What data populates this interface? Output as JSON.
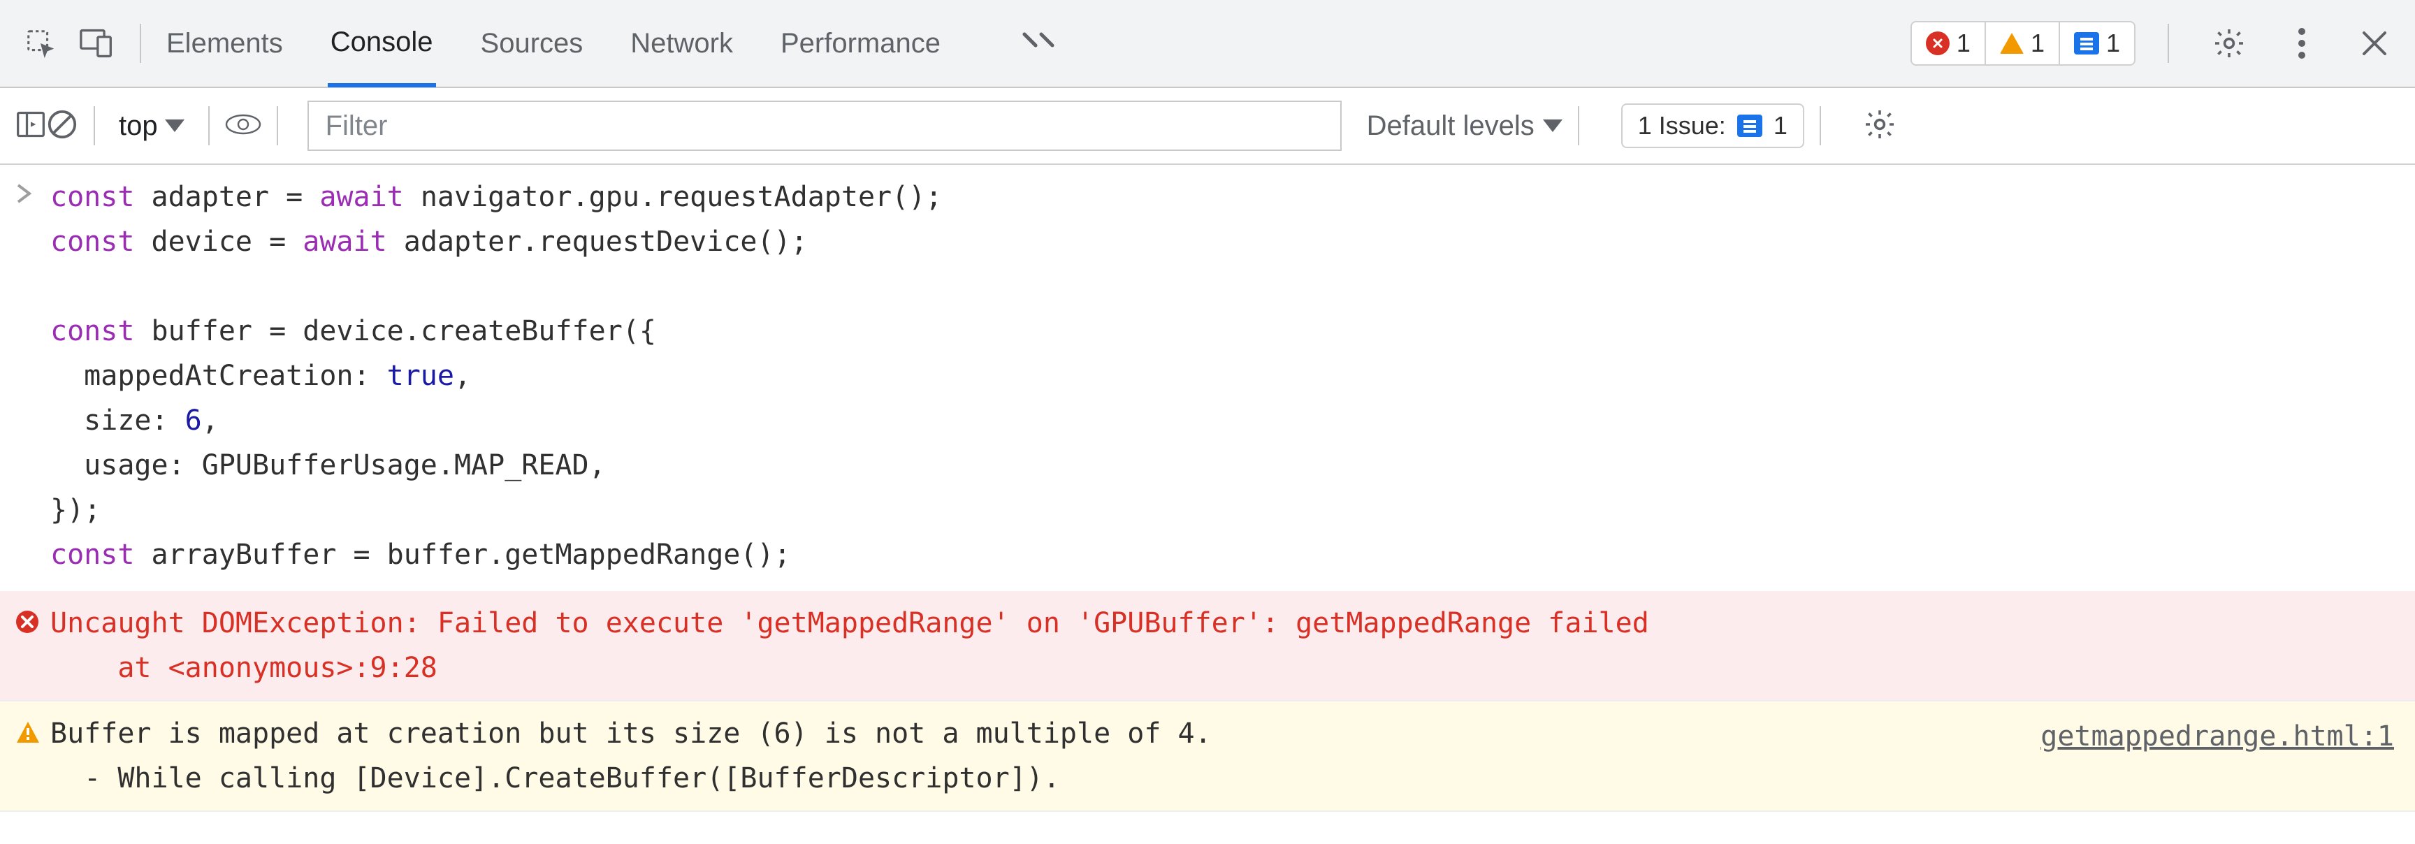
{
  "tabs": {
    "items": [
      "Elements",
      "Console",
      "Sources",
      "Network",
      "Performance"
    ],
    "active_index": 1
  },
  "top_badges": {
    "errors": "1",
    "warnings": "1",
    "info": "1"
  },
  "toolbar": {
    "context": "top",
    "filter_placeholder": "Filter",
    "levels_label": "Default levels",
    "issues_label": "1 Issue:",
    "issues_count": "1"
  },
  "console": {
    "input_code": "const adapter = await navigator.gpu.requestAdapter();\nconst device = await adapter.requestDevice();\n\nconst buffer = device.createBuffer({\n  mappedAtCreation: true,\n  size: 6,\n  usage: GPUBufferUsage.MAP_READ,\n});\nconst arrayBuffer = buffer.getMappedRange();",
    "error_text": "Uncaught DOMException: Failed to execute 'getMappedRange' on 'GPUBuffer': getMappedRange failed\n    at <anonymous>:9:28",
    "warn_text": "Buffer is mapped at creation but its size (6) is not a multiple of 4.\n  - While calling [Device].CreateBuffer([BufferDescriptor]).",
    "warn_source": "getmappedrange.html:1"
  }
}
